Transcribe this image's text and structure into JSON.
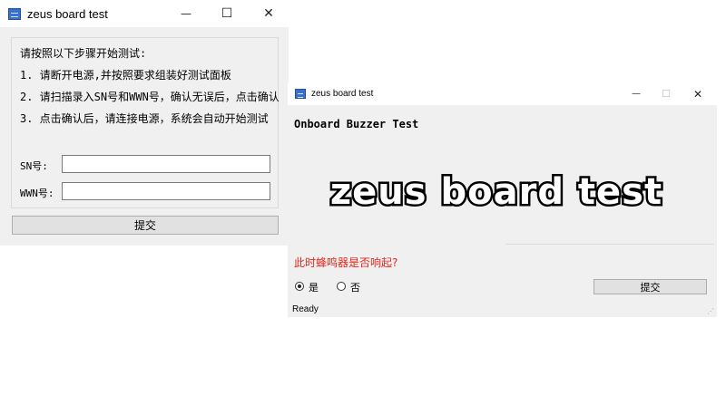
{
  "window1": {
    "title": "zeus board test",
    "controls": {
      "minimize": "—",
      "maximize": "☐",
      "close": "✕"
    },
    "instructions": {
      "heading": "请按照以下步骤开始测试:",
      "step1": "1. 请断开电源,并按照要求组装好测试面板",
      "step2": "2. 请扫描录入SN号和WWN号，确认无误后，点击确认",
      "step3": "3. 点击确认后，请连接电源，系统会自动开始测试"
    },
    "fields": {
      "sn_label": "SN号:",
      "sn_value": "",
      "wwn_label": "WWN号:",
      "wwn_value": ""
    },
    "submit_label": "提交"
  },
  "window2": {
    "title": "zeus board test",
    "controls": {
      "minimize": "—",
      "maximize": "☐",
      "close": "✕"
    },
    "heading": "Onboard Buzzer Test",
    "logo_text": "zeus board test",
    "question": "此时蜂鸣器是否响起?",
    "options": [
      {
        "label": "是",
        "selected": true
      },
      {
        "label": "否",
        "selected": false
      }
    ],
    "submit_label": "提交",
    "status": "Ready"
  },
  "colors": {
    "question_red": "#e8231a",
    "window_bg": "#f0f0f0",
    "titlebar_bg": "#ffffff"
  }
}
